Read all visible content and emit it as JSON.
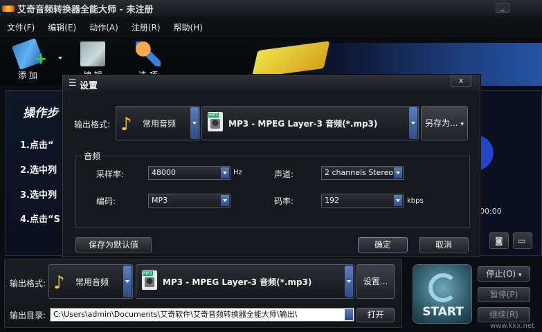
{
  "window": {
    "title": "艾奇音频转换器全能大师 - 未注册",
    "min_label": "_"
  },
  "menu": [
    "文件(F)",
    "编辑(E)",
    "动作(A)",
    "注册(R)",
    "帮助(H)"
  ],
  "toolbar": {
    "add_label": "添 加",
    "edit_label": "编 辑",
    "options_label": "选 项"
  },
  "steps": {
    "title": "操作步",
    "items": [
      "1.点击“",
      "2.选中列",
      "3.选中列",
      "4.点击“S"
    ]
  },
  "player": {
    "time": "00:00"
  },
  "dialog": {
    "title": "设置",
    "close": "x",
    "output_format_label": "输出格式:",
    "category": "常用音频",
    "format": "MP3 - MPEG Layer-3 音频(*.mp3)",
    "save_as_label": "另存为...",
    "audio_group_label": "音频",
    "sample_rate_label": "采样率:",
    "sample_rate": "48000",
    "sample_rate_unit": "Hz",
    "channels_label": "声道:",
    "channels": "2 channels Stereo",
    "codec_label": "编码:",
    "codec": "MP3",
    "bitrate_label": "码率:",
    "bitrate": "192",
    "bitrate_unit": "kbps",
    "save_default_label": "保存为默认值",
    "ok_label": "确定",
    "cancel_label": "取消"
  },
  "bottom": {
    "output_format_label": "输出格式:",
    "category": "常用音频",
    "format": "MP3 - MPEG Layer-3 音频(*.mp3)",
    "settings_label": "设置...",
    "output_dir_label": "输出目录:",
    "output_dir": "C:\\Users\\admin\\Documents\\艾奇软件\\艾奇音频转换器全能大师\\输出\\",
    "open_label": "打开"
  },
  "controls": {
    "start_label": "START",
    "stop_label": "停止(O)",
    "pause_label": "暂停(P)",
    "resume_label": "继续(R)"
  },
  "watermark": "www.kkx.net"
}
